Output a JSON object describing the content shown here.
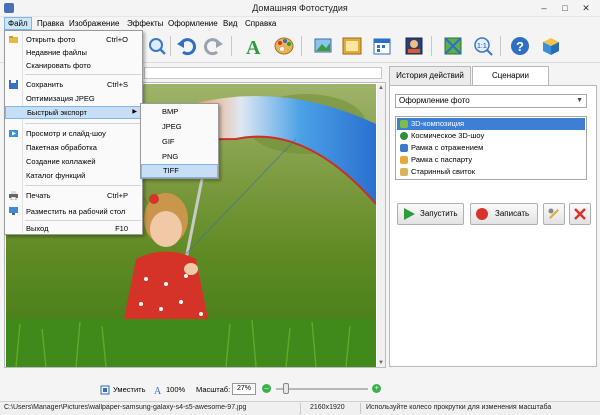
{
  "window": {
    "title": "Домашняя Фотостудия",
    "min": "–",
    "max": "□",
    "close": "✕"
  },
  "menubar": [
    "Файл",
    "Правка",
    "Изображение",
    "Эффекты",
    "Оформление",
    "Вид",
    "Справка"
  ],
  "toolbar_icons": [
    "undo-icon",
    "redo-icon",
    "text-icon",
    "palette-icon",
    "picture-icon",
    "frame-icon",
    "calendar-icon",
    "collage-icon",
    "crop-icon",
    "zoom-1-1-icon",
    "help-icon",
    "box-icon"
  ],
  "file_menu": {
    "items": [
      {
        "label": "Открыть фото",
        "shortcut": "Ctrl+O",
        "icon": "folder-icon"
      },
      {
        "label": "Недавние файлы",
        "shortcut": "",
        "icon": ""
      },
      {
        "label": "Сканировать фото",
        "shortcut": "",
        "icon": ""
      },
      {
        "label": "Сохранить",
        "shortcut": "Ctrl+S",
        "icon": "floppy-icon"
      },
      {
        "label": "Оптимизация JPEG",
        "shortcut": "",
        "icon": ""
      },
      {
        "label": "Быстрый экспорт",
        "shortcut": "",
        "icon": ""
      },
      {
        "label": "Просмотр и слайд-шоу",
        "shortcut": "",
        "icon": "slideshow-icon"
      },
      {
        "label": "Пакетная обработка",
        "shortcut": "",
        "icon": ""
      },
      {
        "label": "Создание коллажей",
        "shortcut": "",
        "icon": ""
      },
      {
        "label": "Каталог функций",
        "shortcut": "",
        "icon": ""
      },
      {
        "label": "Печать",
        "shortcut": "Ctrl+P",
        "icon": "printer-icon"
      },
      {
        "label": "Разместить на рабочий стол",
        "shortcut": "",
        "icon": "desktop-icon"
      },
      {
        "label": "Выход",
        "shortcut": "F10",
        "icon": ""
      }
    ]
  },
  "export_submenu": [
    "BMP",
    "JPEG",
    "GIF",
    "PNG",
    "TIFF"
  ],
  "panel": {
    "tabs": [
      "История действий",
      "Сценарии"
    ],
    "combo_value": "Оформление фото",
    "scenarios": [
      "3D-композиция",
      "Космическое 3D-шоу",
      "Рамка с отражением",
      "Рамка с паспарту",
      "Старинный свиток"
    ],
    "run_label": "Запустить",
    "record_label": "Записать"
  },
  "bottom": {
    "fit_label": "Уместить",
    "full_label": "100%",
    "scale_label": "Масштаб:",
    "scale_value": "27%",
    "zoom_level": 0.08
  },
  "status": {
    "path": "C:\\Users\\Manager\\Pictures\\wallpaper-samsung-galaxy-s4-s5-awesome-97.jpg",
    "dimensions": "2160x1920",
    "hint": "Используйте колесо прокрутки для изменения масштаба"
  },
  "colors": {
    "accent": "#3c7fd4",
    "menu_hover": "#c6def6",
    "green": "#3cb04a",
    "red": "#d9322b"
  }
}
